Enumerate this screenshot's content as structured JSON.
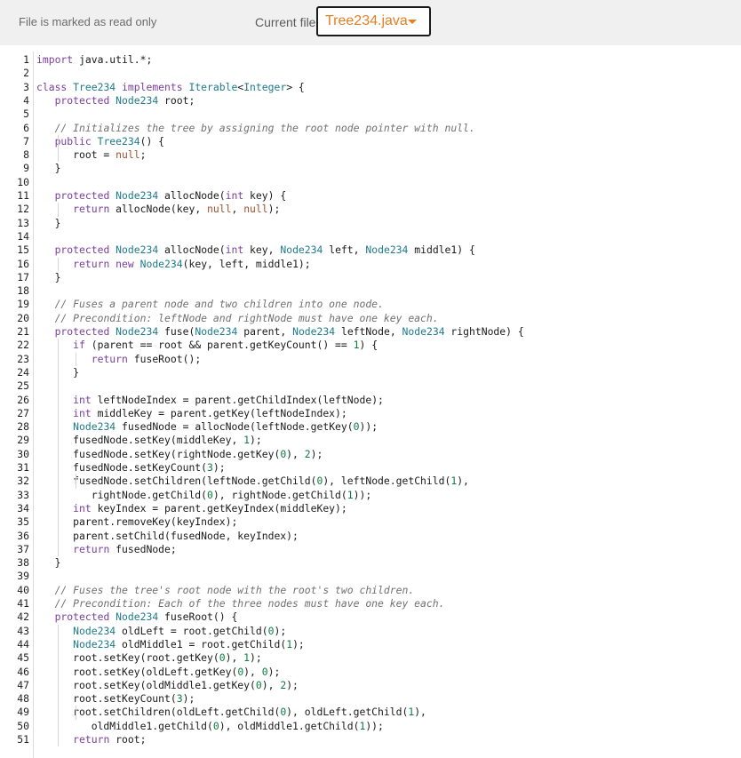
{
  "toolbar": {
    "read_only_notice": "File is marked as read only",
    "current_file_label": "Current file:",
    "current_file": "Tree234.java"
  },
  "editor": {
    "lines": [
      "import java.util.*;",
      "",
      "class Tree234 implements Iterable<Integer> {",
      "   protected Node234 root;",
      "",
      "   // Initializes the tree by assigning the root node pointer with null.",
      "   public Tree234() {",
      "      root = null;",
      "   }",
      "",
      "   protected Node234 allocNode(int key) {",
      "      return allocNode(key, null, null);",
      "   }",
      "",
      "   protected Node234 allocNode(int key, Node234 left, Node234 middle1) {",
      "      return new Node234(key, left, middle1);",
      "   }",
      "",
      "   // Fuses a parent node and two children into one node.",
      "   // Precondition: leftNode and rightNode must have one key each.",
      "   protected Node234 fuse(Node234 parent, Node234 leftNode, Node234 rightNode) {",
      "      if (parent == root && parent.getKeyCount() == 1) {",
      "         return fuseRoot();",
      "      }",
      "",
      "      int leftNodeIndex = parent.getChildIndex(leftNode);",
      "      int middleKey = parent.getKey(leftNodeIndex);",
      "      Node234 fusedNode = allocNode(leftNode.getKey(0));",
      "      fusedNode.setKey(middleKey, 1);",
      "      fusedNode.setKey(rightNode.getKey(0), 2);",
      "      fusedNode.setKeyCount(3);",
      "      fusedNode.setChildren(leftNode.getChild(0), leftNode.getChild(1),",
      "         rightNode.getChild(0), rightNode.getChild(1));",
      "      int keyIndex = parent.getKeyIndex(middleKey);",
      "      parent.removeKey(keyIndex);",
      "      parent.setChild(fusedNode, keyIndex);",
      "      return fusedNode;",
      "   }",
      "",
      "   // Fuses the tree's root node with the root's two children.",
      "   // Precondition: Each of the three nodes must have one key each.",
      "   protected Node234 fuseRoot() {",
      "      Node234 oldLeft = root.getChild(0);",
      "      Node234 oldMiddle1 = root.getChild(1);",
      "      root.setKey(root.getKey(0), 1);",
      "      root.setKey(oldLeft.getKey(0), 0);",
      "      root.setKey(oldMiddle1.getKey(0), 2);",
      "      root.setKeyCount(3);",
      "      root.setChildren(oldLeft.getChild(0), oldLeft.getChild(1),",
      "         oldMiddle1.getChild(0), oldMiddle1.getChild(1));",
      "      return root;"
    ]
  }
}
